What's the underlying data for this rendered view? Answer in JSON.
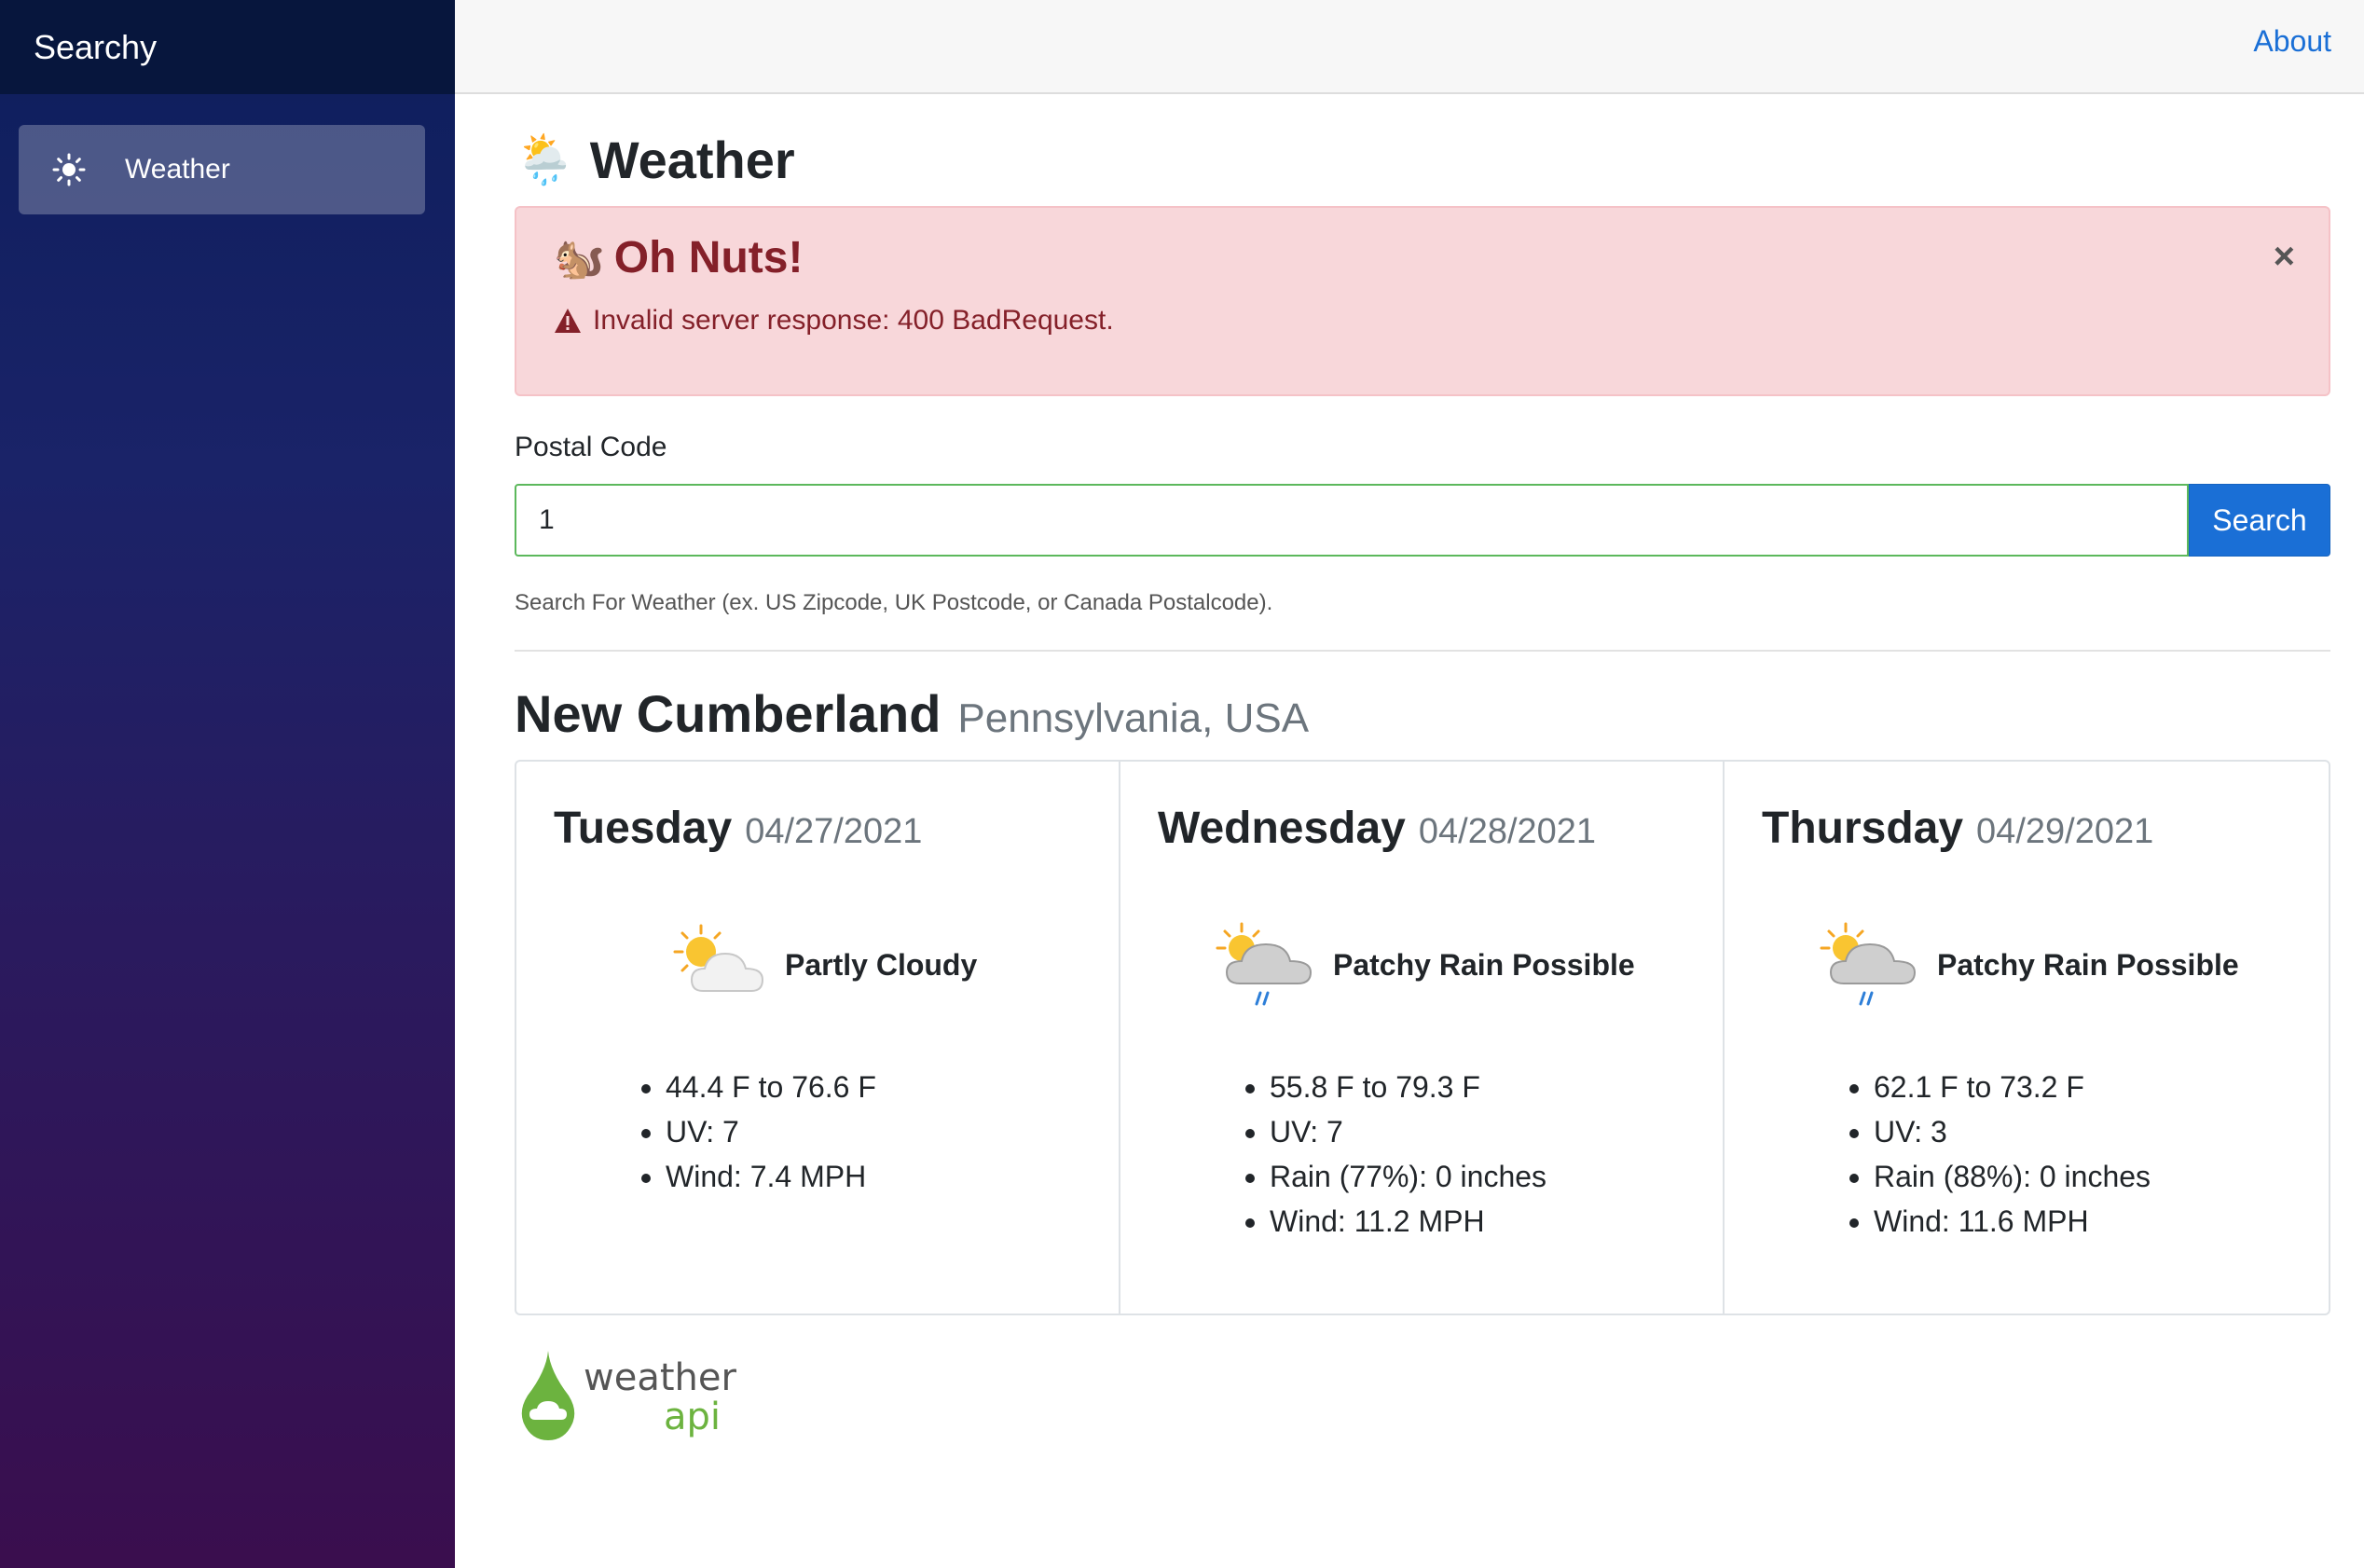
{
  "sidebar": {
    "brand": "Searchy",
    "items": [
      {
        "label": "Weather",
        "icon": "sun-icon"
      }
    ]
  },
  "topbar": {
    "about_label": "About"
  },
  "page": {
    "title": "Weather",
    "title_icon": "🌦️"
  },
  "alert": {
    "icon": "🐿️",
    "title": "Oh Nuts!",
    "message": "Invalid server response: 400 BadRequest.",
    "close_label": "×"
  },
  "search": {
    "label": "Postal Code",
    "value": "1",
    "button_label": "Search",
    "help": "Search For Weather (ex. US Zipcode, UK Postcode, or Canada Postalcode)."
  },
  "location": {
    "city": "New Cumberland",
    "region": "Pennsylvania, USA"
  },
  "forecast": [
    {
      "day": "Tuesday",
      "date": "04/27/2021",
      "condition": "Partly Cloudy",
      "icon": "partly-cloudy-icon",
      "stats": [
        "44.4 F to 76.6 F",
        "UV: 7",
        "Wind: 7.4 MPH"
      ]
    },
    {
      "day": "Wednesday",
      "date": "04/28/2021",
      "condition": "Patchy Rain Possible",
      "icon": "patchy-rain-icon",
      "stats": [
        "55.8 F to 79.3 F",
        "UV: 7",
        "Rain (77%): 0 inches",
        "Wind: 11.2 MPH"
      ]
    },
    {
      "day": "Thursday",
      "date": "04/29/2021",
      "condition": "Patchy Rain Possible",
      "icon": "patchy-rain-icon",
      "stats": [
        "62.1 F to 73.2 F",
        "UV: 3",
        "Rain (88%): 0 inches",
        "Wind: 11.6 MPH"
      ]
    }
  ],
  "footer": {
    "logo_text_1": "weather",
    "logo_text_2": "api"
  },
  "colors": {
    "accent": "#1a6fd6",
    "alert_bg": "#f8d7da",
    "alert_text": "#842029",
    "input_border": "#5cb85c",
    "logo_green": "#6cb33f"
  }
}
